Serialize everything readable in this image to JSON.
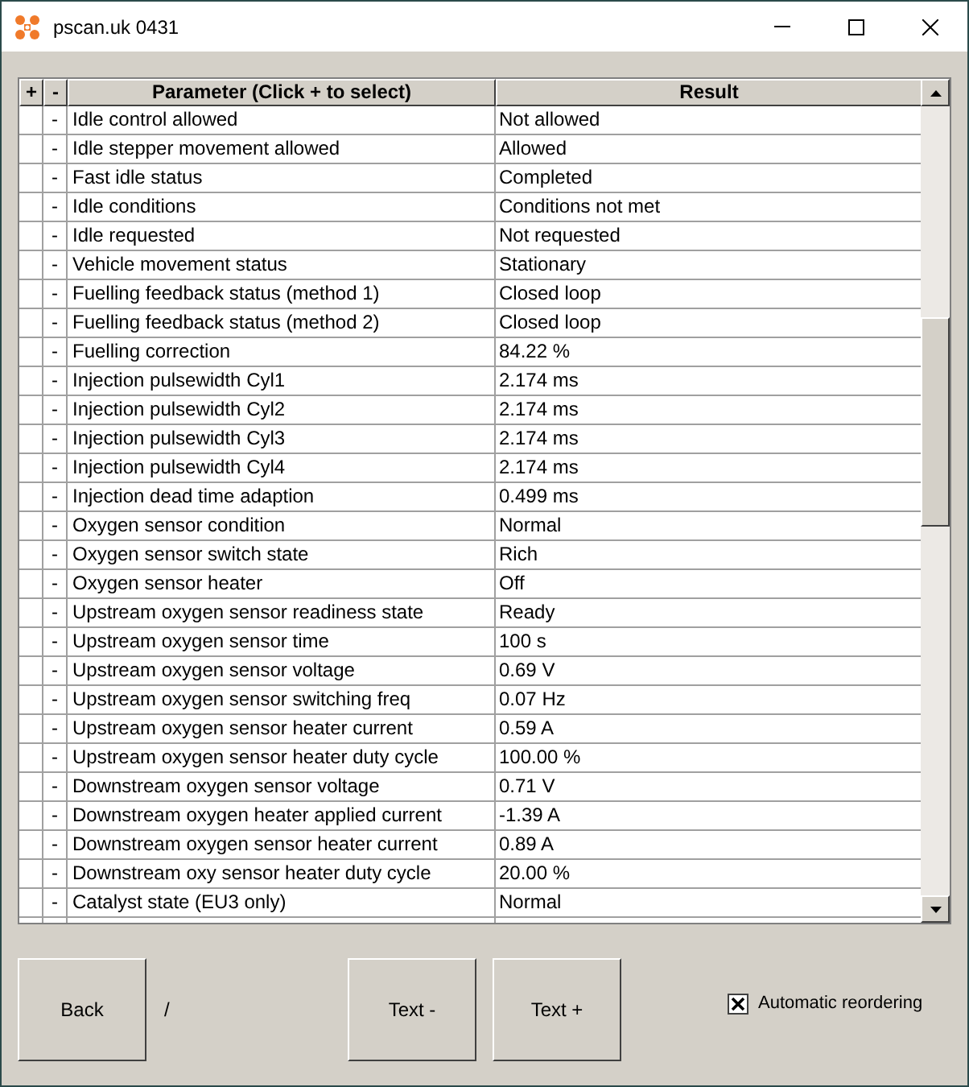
{
  "window": {
    "title": "pscan.uk 0431"
  },
  "table": {
    "columns": [
      "+",
      "-",
      "Parameter (Click + to select)",
      "Result"
    ],
    "rows": [
      {
        "minus": "-",
        "parameter": "Idle control allowed",
        "result": "Not allowed"
      },
      {
        "minus": "-",
        "parameter": "Idle stepper movement allowed",
        "result": "Allowed"
      },
      {
        "minus": "-",
        "parameter": "Fast idle status",
        "result": "Completed"
      },
      {
        "minus": "-",
        "parameter": "Idle conditions",
        "result": "Conditions not met"
      },
      {
        "minus": "-",
        "parameter": "Idle requested",
        "result": "Not requested"
      },
      {
        "minus": "-",
        "parameter": "Vehicle movement status",
        "result": "Stationary"
      },
      {
        "minus": "-",
        "parameter": "Fuelling feedback status (method 1)",
        "result": "Closed loop"
      },
      {
        "minus": "-",
        "parameter": "Fuelling feedback status (method 2)",
        "result": "Closed loop"
      },
      {
        "minus": "-",
        "parameter": "Fuelling correction",
        "result": "84.22 %"
      },
      {
        "minus": "-",
        "parameter": "Injection pulsewidth Cyl1",
        "result": "2.174 ms"
      },
      {
        "minus": "-",
        "parameter": "Injection pulsewidth Cyl2",
        "result": "2.174 ms"
      },
      {
        "minus": "-",
        "parameter": "Injection pulsewidth Cyl3",
        "result": "2.174 ms"
      },
      {
        "minus": "-",
        "parameter": "Injection pulsewidth Cyl4",
        "result": "2.174 ms"
      },
      {
        "minus": "-",
        "parameter": "Injection dead time adaption",
        "result": "0.499 ms"
      },
      {
        "minus": "-",
        "parameter": "Oxygen sensor condition",
        "result": "Normal"
      },
      {
        "minus": "-",
        "parameter": "Oxygen sensor switch state",
        "result": "Rich"
      },
      {
        "minus": "-",
        "parameter": "Oxygen sensor heater",
        "result": "Off"
      },
      {
        "minus": "-",
        "parameter": "Upstream oxygen sensor readiness state",
        "result": "Ready"
      },
      {
        "minus": "-",
        "parameter": "Upstream oxygen sensor time",
        "result": "100 s"
      },
      {
        "minus": "-",
        "parameter": "Upstream oxygen sensor voltage",
        "result": "0.69 V"
      },
      {
        "minus": "-",
        "parameter": "Upstream oxygen sensor switching freq",
        "result": "0.07 Hz"
      },
      {
        "minus": "-",
        "parameter": "Upstream oxygen sensor heater current",
        "result": "0.59 A"
      },
      {
        "minus": "-",
        "parameter": "Upstream oxygen sensor heater duty cycle",
        "result": "100.00 %"
      },
      {
        "minus": "-",
        "parameter": "Downstream oxygen sensor voltage",
        "result": "0.71 V"
      },
      {
        "minus": "-",
        "parameter": "Downstream oxygen heater applied current",
        "result": "-1.39 A"
      },
      {
        "minus": "-",
        "parameter": "Downstream oxygen sensor heater current",
        "result": "0.89 A"
      },
      {
        "minus": "-",
        "parameter": "Downstream oxy sensor heater duty cycle",
        "result": "20.00 %"
      },
      {
        "minus": "-",
        "parameter": "Catalyst state (EU3 only)",
        "result": "Normal"
      }
    ]
  },
  "buttons": {
    "back": "Back",
    "separator": "/",
    "text_minus": "Text -",
    "text_plus": "Text +"
  },
  "auto_reorder": {
    "label": "Automatic reordering",
    "checked": true
  }
}
